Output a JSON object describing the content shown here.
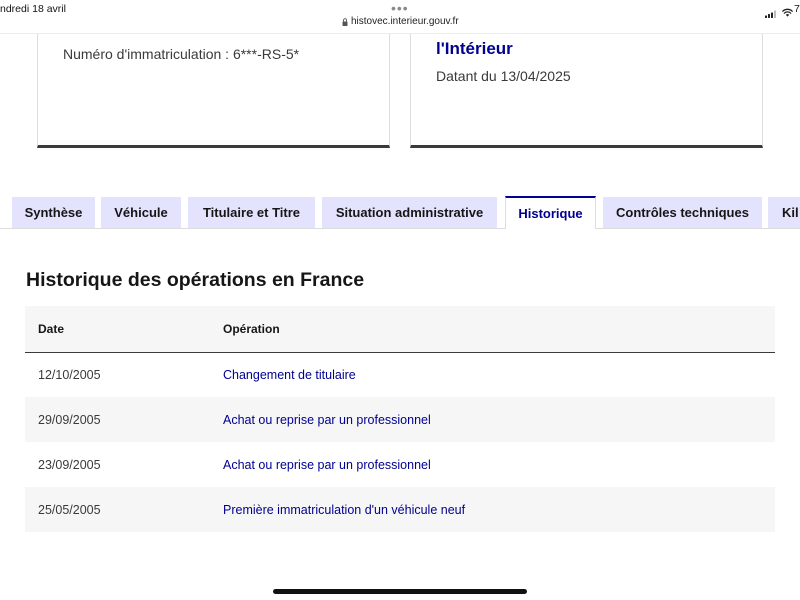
{
  "status_bar": {
    "date": "ndredi 18 avril",
    "dots": "•••",
    "url": "histovec.interieur.gouv.fr",
    "battery_partial": "7",
    "icons": {
      "lock": "lock-icon",
      "signal": "signal-icon",
      "wifi": "wifi-icon"
    }
  },
  "cards": {
    "registration": {
      "text": "Numéro d'immatriculation : 6***-RS-5*"
    },
    "source": {
      "title": "l'Intérieur",
      "date": "Datant du 13/04/2025"
    }
  },
  "tabs": [
    {
      "label": "Synthèse",
      "selected": false
    },
    {
      "label": "Véhicule",
      "selected": false
    },
    {
      "label": "Titulaire et Titre",
      "selected": false
    },
    {
      "label": "Situation administrative",
      "selected": false
    },
    {
      "label": "Historique",
      "selected": true
    },
    {
      "label": "Contrôles techniques",
      "selected": false
    },
    {
      "label": "Kil",
      "selected": false
    }
  ],
  "history": {
    "heading": "Historique des opérations en France",
    "columns": {
      "date": "Date",
      "operation": "Opération"
    },
    "rows": [
      {
        "date": "12/10/2005",
        "operation": "Changement de titulaire"
      },
      {
        "date": "29/09/2005",
        "operation": "Achat ou reprise par un professionnel"
      },
      {
        "date": "23/09/2005",
        "operation": "Achat ou reprise par un professionnel"
      },
      {
        "date": "25/05/2005",
        "operation": "Première immatriculation d'un véhicule neuf"
      }
    ]
  },
  "colors": {
    "accent": "#000091",
    "text": "#161616",
    "muted_text": "#3a3a3a",
    "tab_background": "#e3e3fd",
    "table_header_background": "#f6f6f6",
    "row_stripe": "#f6f6f6",
    "border": "#dddddd"
  }
}
